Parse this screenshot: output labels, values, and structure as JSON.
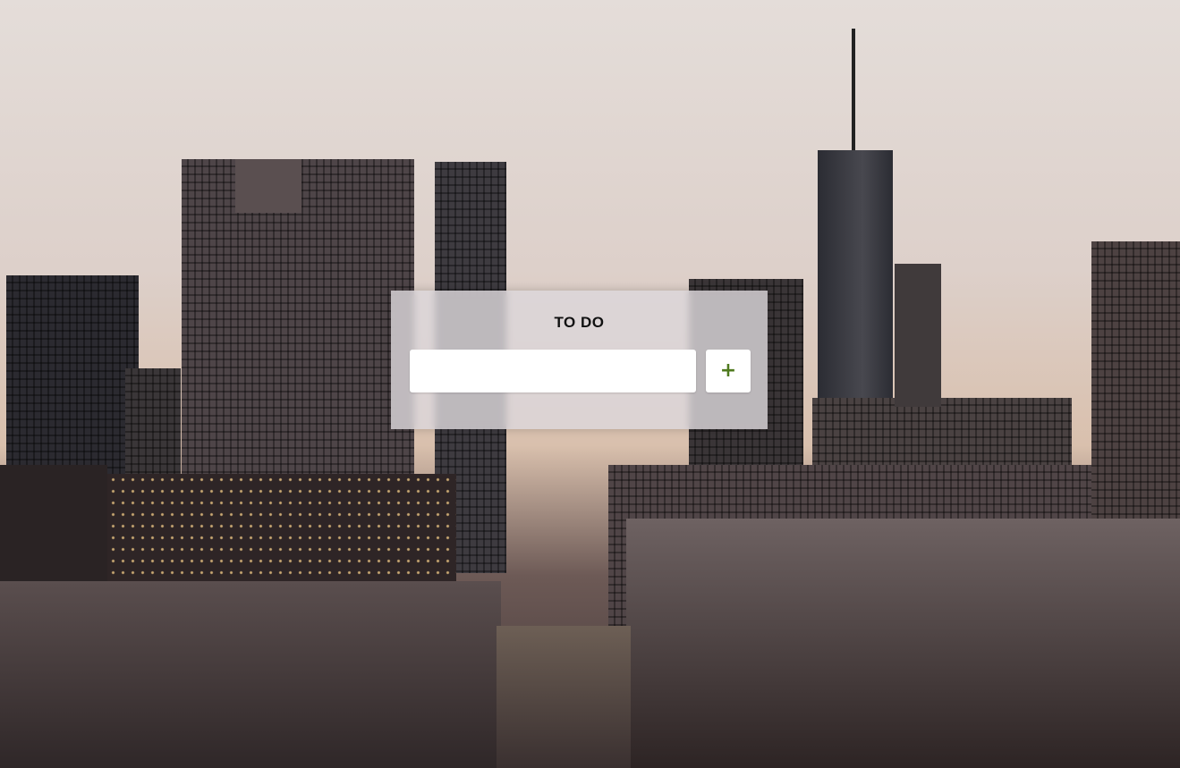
{
  "todo": {
    "title": "TO DO",
    "input_value": "",
    "input_placeholder": "",
    "add_button_label": "+",
    "accent_color": "#4f7a1e"
  },
  "background": {
    "icon": "city-skyline-photo"
  }
}
